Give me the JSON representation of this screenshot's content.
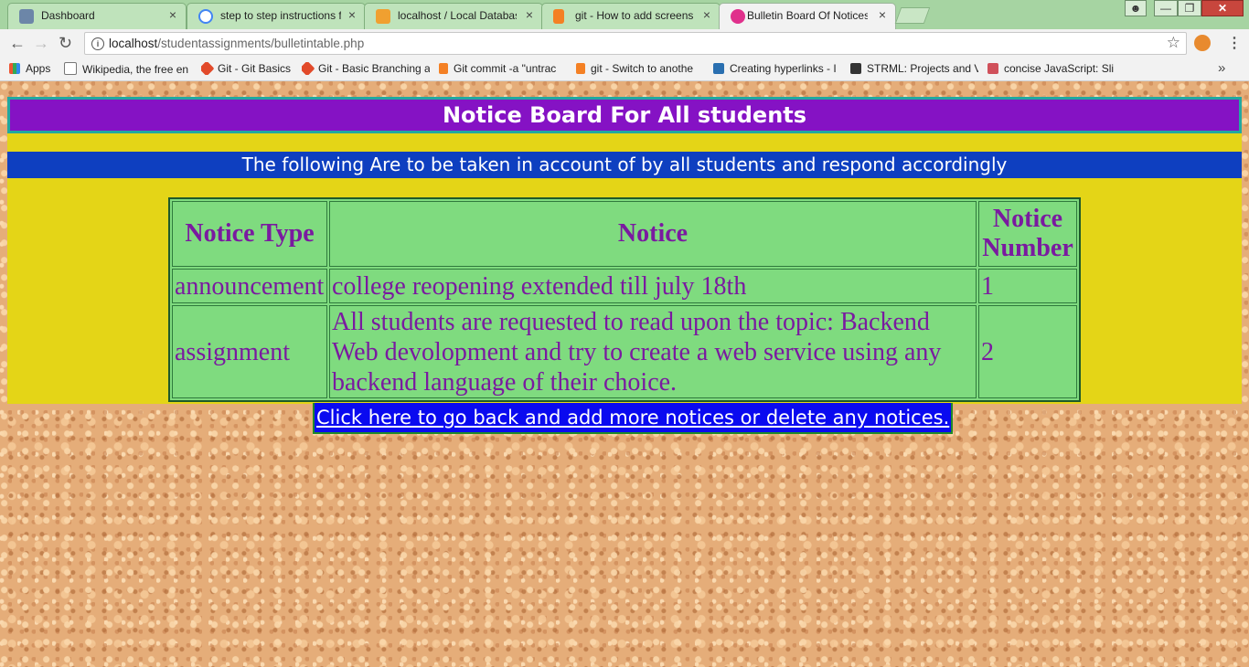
{
  "browser": {
    "tabs": [
      {
        "title": "Dashboard",
        "close": "×"
      },
      {
        "title": "step to step instructions f",
        "close": "×"
      },
      {
        "title": "localhost / Local Databas",
        "close": "×"
      },
      {
        "title": "git - How to add screens",
        "close": "×"
      },
      {
        "title": "Bulletin Board Of Notices",
        "close": "×"
      }
    ],
    "url": {
      "host": "localhost",
      "path": "/studentassignments/bulletintable.php"
    },
    "bookmarks": [
      {
        "label": "Apps",
        "icon": "apps-grid-icon"
      },
      {
        "label": "Wikipedia, the free en",
        "icon": "wikipedia-icon"
      },
      {
        "label": "Git - Git Basics",
        "icon": "git-icon"
      },
      {
        "label": "Git - Basic Branching a",
        "icon": "git-icon"
      },
      {
        "label": "Git commit -a \"untrac",
        "icon": "stackoverflow-icon"
      },
      {
        "label": "git - Switch to anothe",
        "icon": "stackoverflow-icon"
      },
      {
        "label": "Creating hyperlinks - I",
        "icon": "link-icon"
      },
      {
        "label": "STRML: Projects and V",
        "icon": "code-icon"
      },
      {
        "label": "concise JavaScript: Sli",
        "icon": "slides-icon"
      }
    ],
    "more_label": "»"
  },
  "page": {
    "banner_title": "Notice Board For All students",
    "subtitle": "The following Are to be taken in account of by all students and respond accordingly",
    "table": {
      "headers": [
        "Notice Type",
        "Notice",
        "Notice Number"
      ],
      "rows": [
        [
          "announcement",
          "college reopening extended till july 18th",
          "1"
        ],
        [
          "assignment",
          "All students are requested to read upon the topic: Backend Web devolopment and try to create a web service using any backend language of their choice.",
          "2"
        ]
      ]
    },
    "back_link": "Click here to go back and add more notices or delete any notices."
  }
}
